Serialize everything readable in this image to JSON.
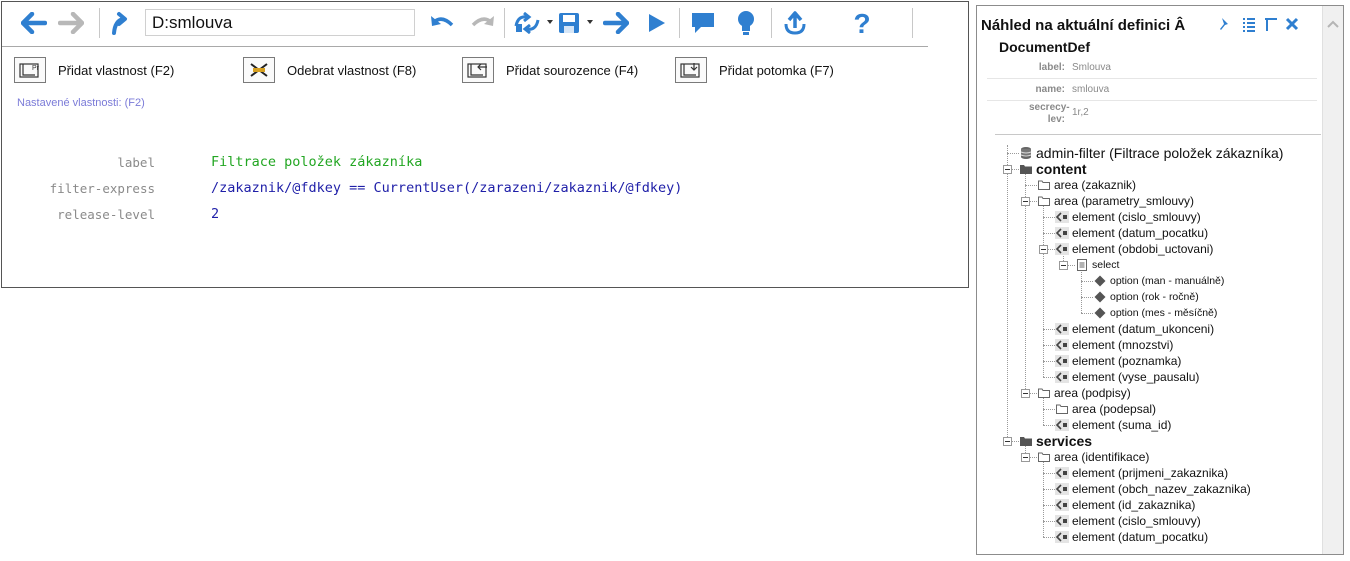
{
  "toolbar": {
    "path_value": "D:smlouva",
    "icons": [
      "back-arrow-icon",
      "forward-arrow-icon",
      "up-icon",
      "undo-icon",
      "redo-icon",
      "compile-icon",
      "save-icon",
      "go-icon",
      "run-icon",
      "comment-icon",
      "lightbulb-icon",
      "publish-icon",
      "help-icon"
    ],
    "accent_color": "#2f7fd0"
  },
  "actions": [
    {
      "label": "Přidat vlastnost (F2)",
      "icon": "add-property-icon"
    },
    {
      "label": "Odebrat vlastnost (F8)",
      "icon": "remove-property-icon"
    },
    {
      "label": "Přidat sourozence (F4)",
      "icon": "add-sibling-icon"
    },
    {
      "label": "Přidat potomka (F7)",
      "icon": "add-child-icon"
    }
  ],
  "set_properties_label": "Nastavené vlastnosti: (F2)",
  "properties": [
    {
      "key": "label",
      "value": "Filtrace položek zákazníka",
      "color": "#22a622"
    },
    {
      "key": "filter-express",
      "value": "/zakaznik/@fdkey == CurrentUser(/zarazeni/zakaznik/@fdkey)",
      "color": "#1f1fa8"
    },
    {
      "key": "release-level",
      "value": "2",
      "color": "#1f1fa8"
    }
  ],
  "preview": {
    "title": "Náhled na aktuální definici Â",
    "doc_title": "DocumentDef",
    "meta": [
      {
        "key": "label:",
        "value": "Smlouva"
      },
      {
        "key": "name:",
        "value": "smlouva"
      },
      {
        "key": "secrecy-lev:",
        "value": "1r,2"
      }
    ],
    "tree": [
      {
        "label": "admin-filter (Filtrace položek zákazníka)",
        "level": 0,
        "icon": "database-icon",
        "toggle": false,
        "bold": false
      },
      {
        "label": "content",
        "level": 0,
        "icon": "folder-filled-icon",
        "toggle": true,
        "bold": true
      },
      {
        "label": "area (zakaznik)",
        "level": 1,
        "icon": "folder-icon",
        "toggle": false
      },
      {
        "label": "area (parametry_smlouvy)",
        "level": 1,
        "icon": "folder-icon",
        "toggle": true
      },
      {
        "label": "element (cislo_smlouvy)",
        "level": 2,
        "icon": "element-icon",
        "toggle": false
      },
      {
        "label": "element (datum_pocatku)",
        "level": 2,
        "icon": "element-icon",
        "toggle": false
      },
      {
        "label": "element (obdobi_uctovani)",
        "level": 2,
        "icon": "element-icon",
        "toggle": true
      },
      {
        "label": "select",
        "level": 3,
        "icon": "select-icon",
        "toggle": true
      },
      {
        "label": "option (man - manuálně)",
        "level": 4,
        "icon": "option-icon",
        "toggle": false
      },
      {
        "label": "option (rok - ročně)",
        "level": 4,
        "icon": "option-icon",
        "toggle": false
      },
      {
        "label": "option (mes - měsíčně)",
        "level": 4,
        "icon": "option-icon",
        "toggle": false
      },
      {
        "label": "element (datum_ukonceni)",
        "level": 2,
        "icon": "element-icon",
        "toggle": false
      },
      {
        "label": "element (mnozstvi)",
        "level": 2,
        "icon": "element-icon",
        "toggle": false
      },
      {
        "label": "element (poznamka)",
        "level": 2,
        "icon": "element-icon",
        "toggle": false
      },
      {
        "label": "element (vyse_pausalu)",
        "level": 2,
        "icon": "element-icon",
        "toggle": false
      },
      {
        "label": "area (podpisy)",
        "level": 1,
        "icon": "folder-icon",
        "toggle": true
      },
      {
        "label": "area (podepsal)",
        "level": 2,
        "icon": "folder-icon",
        "toggle": false
      },
      {
        "label": "element (suma_id)",
        "level": 2,
        "icon": "element-icon",
        "toggle": false
      },
      {
        "label": "services",
        "level": 0,
        "icon": "folder-filled-icon",
        "toggle": true,
        "bold": true
      },
      {
        "label": "area (identifikace)",
        "level": 1,
        "icon": "folder-icon",
        "toggle": true
      },
      {
        "label": "element (prijmeni_zakaznika)",
        "level": 2,
        "icon": "element-icon",
        "toggle": false
      },
      {
        "label": "element (obch_nazev_zakaznika)",
        "level": 2,
        "icon": "element-icon",
        "toggle": false
      },
      {
        "label": "element (id_zakaznika)",
        "level": 2,
        "icon": "element-icon",
        "toggle": false
      },
      {
        "label": "element (cislo_smlouvy)",
        "level": 2,
        "icon": "element-icon",
        "toggle": false
      },
      {
        "label": "element (datum_pocatku)",
        "level": 2,
        "icon": "element-icon",
        "toggle": false
      }
    ]
  }
}
